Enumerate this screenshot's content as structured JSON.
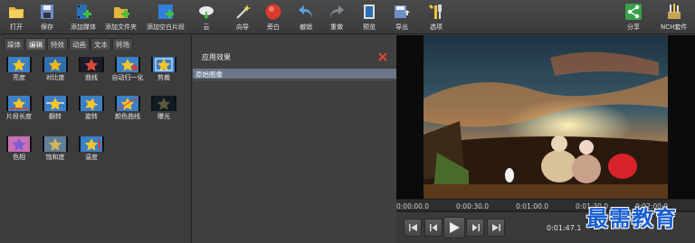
{
  "toolbar": {
    "open": "打开",
    "save": "保存",
    "add_media": "添加媒体",
    "add_folder": "添加文件夹",
    "add_blank_clip": "添加空白片段",
    "cloud": "云",
    "wizard": "向导",
    "narration": "旁白",
    "undo": "撤销",
    "redo": "重做",
    "preview": "预览",
    "export": "导出",
    "options": "选项",
    "share": "分享",
    "nch_suite": "NCH套件"
  },
  "tabs": [
    "媒体",
    "编辑",
    "特效",
    "动画",
    "文本",
    "转场"
  ],
  "active_tab": "编辑",
  "effects": [
    "亮度",
    "对比度",
    "曲线",
    "自动归一化",
    "剪裁",
    "片段长度",
    "翻转",
    "旋转",
    "颜色曲线",
    "曝光",
    "色相",
    "饱和度",
    "温度"
  ],
  "applied": {
    "header": "应用效果",
    "item": "原始图像"
  },
  "timeline": {
    "ticks": [
      "0:00:00.0",
      "0:00:30.0",
      "0:01:00.0",
      "0:01:30.0",
      "0:02:00.0"
    ]
  },
  "player": {
    "current_time": "0:01:47.1"
  },
  "watermark": "最需教育",
  "colors": {
    "accent": "#1a5fd1",
    "selected_row": "#6b7689",
    "record_red": "#d93a2b"
  }
}
